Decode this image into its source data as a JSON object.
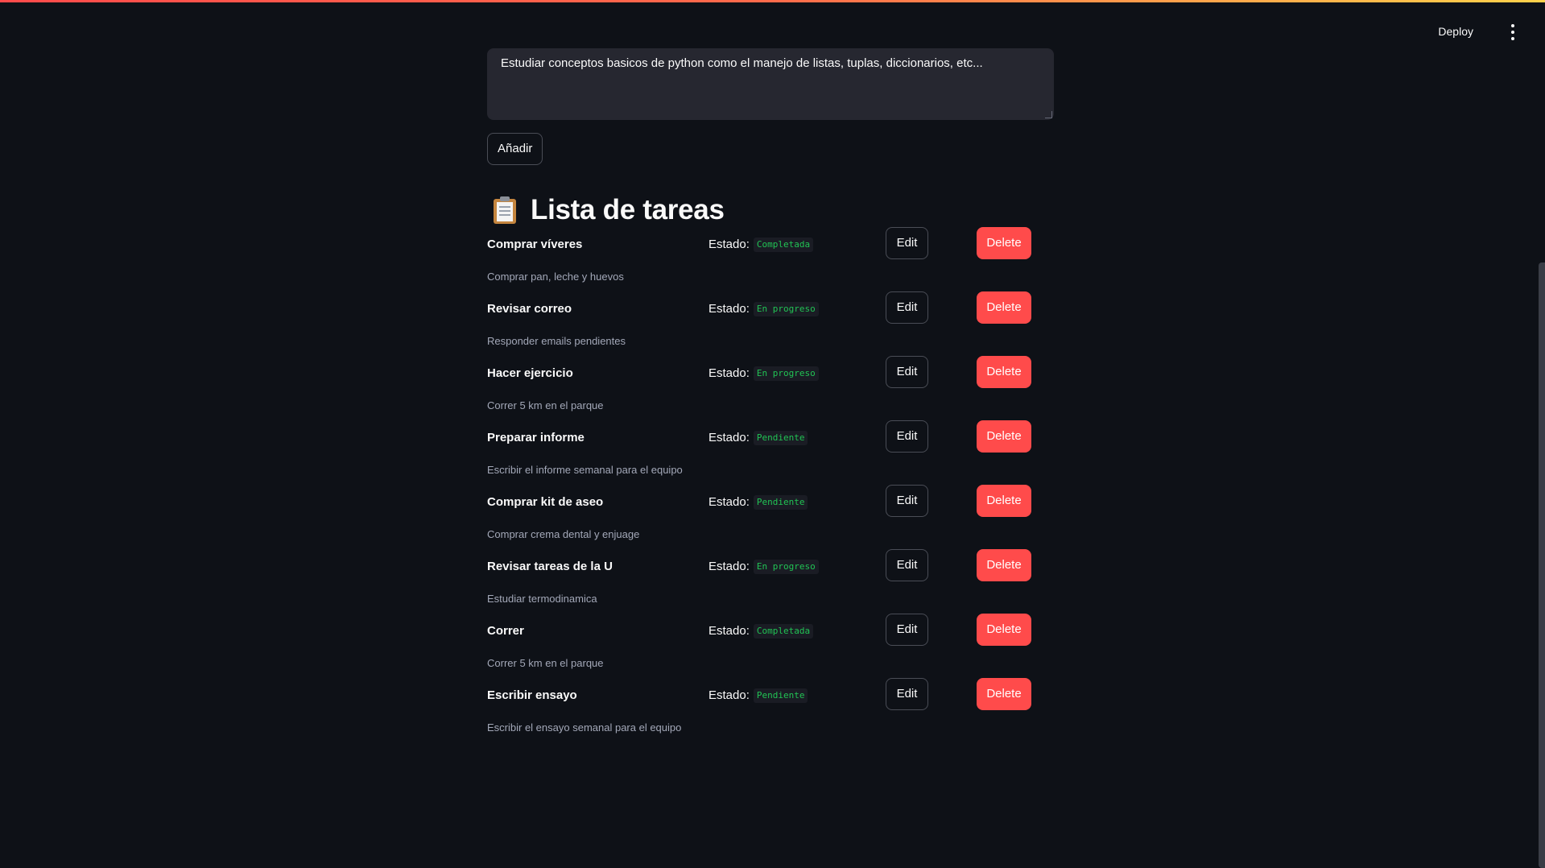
{
  "header": {
    "deploy_label": "Deploy",
    "menu_icon": "kebab-menu-icon"
  },
  "form": {
    "description_value": "Estudiar conceptos basicos de python como el manejo de listas, tuplas, diccionarios, etc...",
    "add_label": "Añadir"
  },
  "section": {
    "icon": "clipboard-icon",
    "title": "Lista de tareas"
  },
  "labels": {
    "status_prefix": "Estado:",
    "edit": "Edit",
    "delete": "Delete"
  },
  "colors": {
    "background": "#0e1117",
    "delete_button": "#ff4b4b",
    "status_text": "#21c354"
  },
  "tasks": [
    {
      "title": "Comprar víveres",
      "description": "Comprar pan, leche y huevos",
      "status": "Completada"
    },
    {
      "title": "Revisar correo",
      "description": "Responder emails pendientes",
      "status": "En progreso"
    },
    {
      "title": "Hacer ejercicio",
      "description": "Correr 5 km en el parque",
      "status": "En progreso"
    },
    {
      "title": "Preparar informe",
      "description": "Escribir el informe semanal para el equipo",
      "status": "Pendiente"
    },
    {
      "title": "Comprar kit de aseo",
      "description": "Comprar crema dental y enjuage",
      "status": "Pendiente"
    },
    {
      "title": "Revisar tareas de la U",
      "description": "Estudiar termodinamica",
      "status": "En progreso"
    },
    {
      "title": "Correr",
      "description": "Correr 5 km en el parque",
      "status": "Completada"
    },
    {
      "title": "Escribir ensayo",
      "description": "Escribir el ensayo semanal para el equipo",
      "status": "Pendiente"
    }
  ]
}
